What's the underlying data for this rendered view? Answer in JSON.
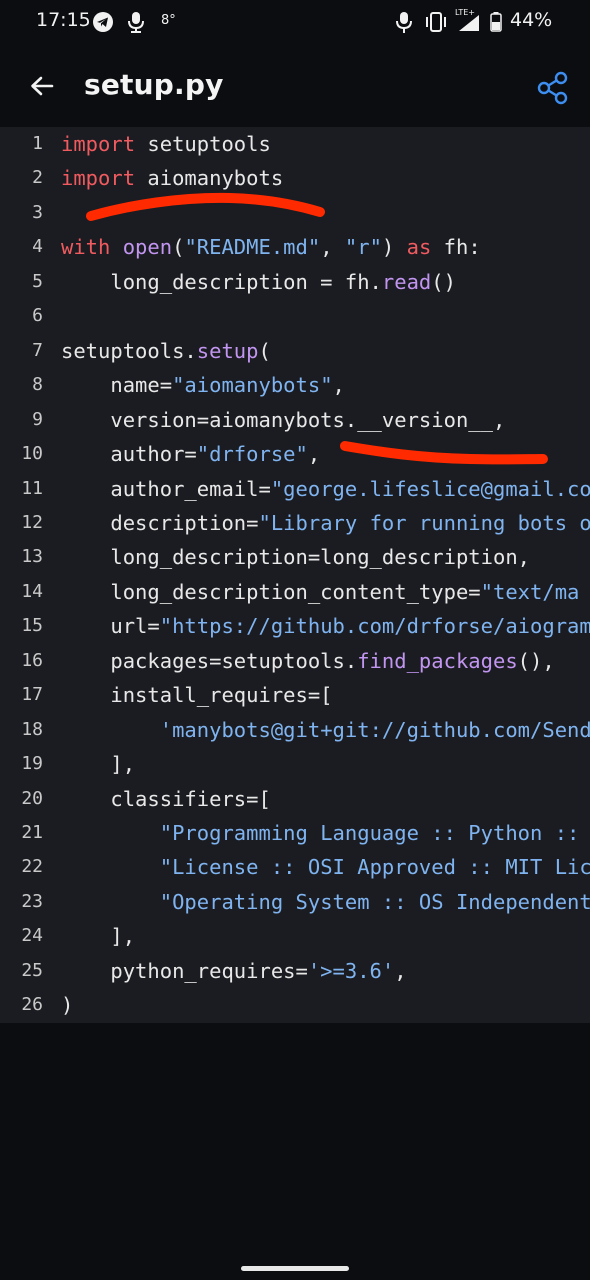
{
  "status_bar": {
    "time": "17:15",
    "temperature": "8°",
    "battery": "44%",
    "network": "LTE+",
    "icons": [
      "telegram-icon",
      "microphone-icon",
      "mic-icon",
      "vibrate-icon",
      "signal-icon",
      "battery-icon"
    ]
  },
  "app_bar": {
    "title": "setup.py",
    "back_icon": "arrow-left-icon",
    "share_icon": "share-icon",
    "accent_color": "#3d8ef0"
  },
  "colors": {
    "keyword": "#f05b60",
    "string": "#7fb4f0",
    "function": "#c195f0",
    "text": "#e8e8e8",
    "annotation": "#ff2a00"
  },
  "code": {
    "language": "python",
    "lines": [
      {
        "n": "1",
        "tokens": [
          [
            "kw",
            "import"
          ],
          [
            "plain",
            " setuptools"
          ]
        ]
      },
      {
        "n": "2",
        "tokens": [
          [
            "kw",
            "import"
          ],
          [
            "plain",
            " aiomanybots"
          ]
        ]
      },
      {
        "n": "3",
        "tokens": []
      },
      {
        "n": "4",
        "tokens": [
          [
            "kw",
            "with"
          ],
          [
            "plain",
            " "
          ],
          [
            "fn",
            "open"
          ],
          [
            "plain",
            "("
          ],
          [
            "str",
            "\"README.md\""
          ],
          [
            "plain",
            ", "
          ],
          [
            "str",
            "\"r\""
          ],
          [
            "plain",
            ") "
          ],
          [
            "kw",
            "as"
          ],
          [
            "plain",
            " fh:"
          ]
        ]
      },
      {
        "n": "5",
        "tokens": [
          [
            "plain",
            "    long_description = fh."
          ],
          [
            "fn",
            "read"
          ],
          [
            "plain",
            "()"
          ]
        ]
      },
      {
        "n": "6",
        "tokens": []
      },
      {
        "n": "7",
        "tokens": [
          [
            "plain",
            "setuptools."
          ],
          [
            "fn",
            "setup"
          ],
          [
            "plain",
            "("
          ]
        ]
      },
      {
        "n": "8",
        "tokens": [
          [
            "plain",
            "    name="
          ],
          [
            "str",
            "\"aiomanybots\""
          ],
          [
            "plain",
            ","
          ]
        ]
      },
      {
        "n": "9",
        "tokens": [
          [
            "plain",
            "    version=aiomanybots.__version__,"
          ]
        ]
      },
      {
        "n": "10",
        "tokens": [
          [
            "plain",
            "    author="
          ],
          [
            "str",
            "\"drforse\""
          ],
          [
            "plain",
            ","
          ]
        ]
      },
      {
        "n": "11",
        "tokens": [
          [
            "plain",
            "    author_email="
          ],
          [
            "str",
            "\"george.lifeslice@gmail.co"
          ]
        ]
      },
      {
        "n": "12",
        "tokens": [
          [
            "plain",
            "    description="
          ],
          [
            "str",
            "\"Library for running bots o"
          ]
        ]
      },
      {
        "n": "13",
        "tokens": [
          [
            "plain",
            "    long_description=long_description,"
          ]
        ]
      },
      {
        "n": "14",
        "tokens": [
          [
            "plain",
            "    long_description_content_type="
          ],
          [
            "str",
            "\"text/ma"
          ]
        ]
      },
      {
        "n": "15",
        "tokens": [
          [
            "plain",
            "    url="
          ],
          [
            "str",
            "\"https://github.com/drforse/aiogram"
          ]
        ]
      },
      {
        "n": "16",
        "tokens": [
          [
            "plain",
            "    packages=setuptools."
          ],
          [
            "fn",
            "find_packages"
          ],
          [
            "plain",
            "(),"
          ]
        ]
      },
      {
        "n": "17",
        "tokens": [
          [
            "plain",
            "    install_requires=["
          ]
        ]
      },
      {
        "n": "18",
        "tokens": [
          [
            "plain",
            "        "
          ],
          [
            "str",
            "'manybots@git+git://github.com/Send"
          ]
        ]
      },
      {
        "n": "19",
        "tokens": [
          [
            "plain",
            "    ],"
          ]
        ]
      },
      {
        "n": "20",
        "tokens": [
          [
            "plain",
            "    classifiers=["
          ]
        ]
      },
      {
        "n": "21",
        "tokens": [
          [
            "plain",
            "        "
          ],
          [
            "str",
            "\"Programming Language :: Python :: "
          ]
        ]
      },
      {
        "n": "22",
        "tokens": [
          [
            "plain",
            "        "
          ],
          [
            "str",
            "\"License :: OSI Approved :: MIT Lic"
          ]
        ]
      },
      {
        "n": "23",
        "tokens": [
          [
            "plain",
            "        "
          ],
          [
            "str",
            "\"Operating System :: OS Independent"
          ]
        ]
      },
      {
        "n": "24",
        "tokens": [
          [
            "plain",
            "    ],"
          ]
        ]
      },
      {
        "n": "25",
        "tokens": [
          [
            "plain",
            "    python_requires="
          ],
          [
            "str",
            "'>=3.6'"
          ],
          [
            "plain",
            ","
          ]
        ]
      },
      {
        "n": "26",
        "tokens": [
          [
            "plain",
            ")"
          ]
        ]
      }
    ]
  }
}
